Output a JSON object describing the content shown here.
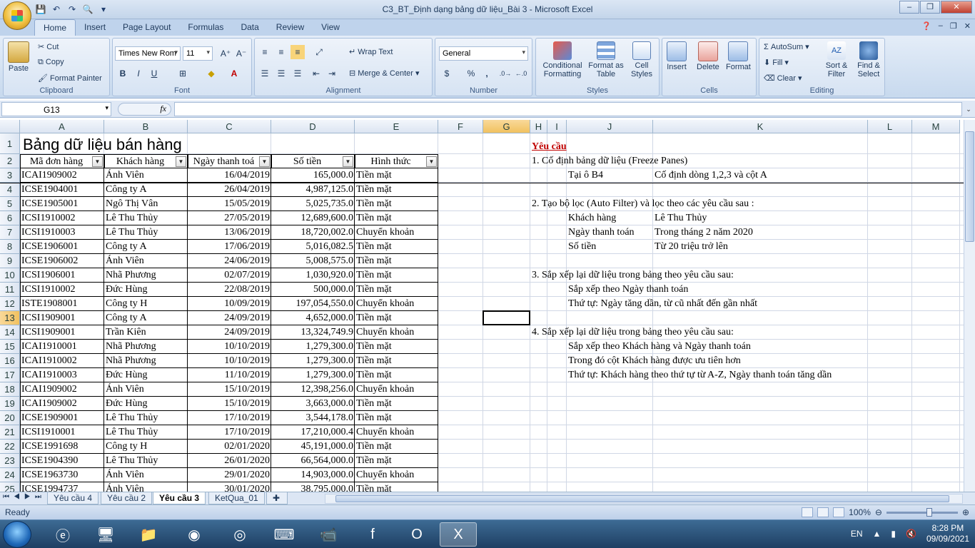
{
  "window": {
    "title": "C3_BT_Định dạng bảng dữ liệu_Bài 3 - Microsoft Excel"
  },
  "ribbon_tabs": [
    "Home",
    "Insert",
    "Page Layout",
    "Formulas",
    "Data",
    "Review",
    "View"
  ],
  "ribbon": {
    "clipboard": {
      "paste": "Paste",
      "cut": "Cut",
      "copy": "Copy",
      "format_painter": "Format Painter",
      "label": "Clipboard"
    },
    "font": {
      "name": "Times New Rom",
      "size": "11",
      "label": "Font",
      "bold": "B",
      "italic": "I",
      "underline": "U"
    },
    "alignment": {
      "wrap": "Wrap Text",
      "merge": "Merge & Center",
      "label": "Alignment"
    },
    "number": {
      "format": "General",
      "label": "Number",
      "currency": "$",
      "percent": "%",
      "comma": ","
    },
    "styles": {
      "conditional": "Conditional Formatting",
      "table": "Format as Table",
      "cell": "Cell Styles",
      "label": "Styles"
    },
    "cells": {
      "insert": "Insert",
      "delete": "Delete",
      "format": "Format",
      "label": "Cells"
    },
    "editing": {
      "autosum": "AutoSum",
      "fill": "Fill",
      "clear": "Clear",
      "sort": "Sort & Filter",
      "find": "Find & Select",
      "label": "Editing"
    }
  },
  "formula_bar": {
    "name_box": "G13",
    "fx": "fx",
    "value": ""
  },
  "columns": [
    "A",
    "B",
    "C",
    "D",
    "E",
    "F",
    "G",
    "H",
    "I",
    "J",
    "K",
    "L",
    "M"
  ],
  "rows": [
    "1",
    "2",
    "3",
    "4",
    "5",
    "6",
    "7",
    "8",
    "9",
    "10",
    "11",
    "12",
    "13",
    "14",
    "15",
    "16",
    "17",
    "18",
    "19",
    "20",
    "21",
    "22",
    "23",
    "24",
    "25"
  ],
  "sheet": {
    "title": "Bảng dữ liệu bán hàng",
    "headers": [
      "Mã đơn hàng",
      "Khách hàng",
      "Ngày thanh toá",
      "Số tiền",
      "Hình thức"
    ],
    "data": [
      [
        "ICAI1909002",
        "Ánh Viên",
        "16/04/2019",
        "165,000.0",
        "Tiền mặt"
      ],
      [
        "ICSE1904001",
        "Công ty A",
        "26/04/2019",
        "4,987,125.0",
        "Tiền mặt"
      ],
      [
        "ICSE1905001",
        "Ngô Thị Vân",
        "15/05/2019",
        "5,025,735.0",
        "Tiền mặt"
      ],
      [
        "ICSI1910002",
        "Lê Thu Thủy",
        "27/05/2019",
        "12,689,600.0",
        "Tiền mặt"
      ],
      [
        "ICSI1910003",
        "Lê Thu Thủy",
        "13/06/2019",
        "18,720,002.0",
        "Chuyển khoản"
      ],
      [
        "ICSE1906001",
        "Công ty A",
        "17/06/2019",
        "5,016,082.5",
        "Tiền mặt"
      ],
      [
        "ICSE1906002",
        "Ánh Viên",
        "24/06/2019",
        "5,008,575.0",
        "Tiền mặt"
      ],
      [
        "ICSI1906001",
        "Nhã Phương",
        "02/07/2019",
        "1,030,920.0",
        "Tiền mặt"
      ],
      [
        "ICSI1910002",
        "Đức Hùng",
        "22/08/2019",
        "500,000.0",
        "Tiền mặt"
      ],
      [
        "ISTE1908001",
        "Công ty H",
        "10/09/2019",
        "197,054,550.0",
        "Chuyển khoản"
      ],
      [
        "ICSI1909001",
        "Công ty A",
        "24/09/2019",
        "4,652,000.0",
        "Tiền mặt"
      ],
      [
        "ICSI1909001",
        "Trần Kiên",
        "24/09/2019",
        "13,324,749.9",
        "Chuyển khoản"
      ],
      [
        "ICAI1910001",
        "Nhã Phương",
        "10/10/2019",
        "1,279,300.0",
        "Tiền mặt"
      ],
      [
        "ICAI1910002",
        "Nhã Phương",
        "10/10/2019",
        "1,279,300.0",
        "Tiền mặt"
      ],
      [
        "ICAI1910003",
        "Đức Hùng",
        "11/10/2019",
        "1,279,300.0",
        "Tiền mặt"
      ],
      [
        "ICAI1909002",
        "Ánh Viên",
        "15/10/2019",
        "12,398,256.0",
        "Chuyển khoản"
      ],
      [
        "ICAI1909002",
        "Đức Hùng",
        "15/10/2019",
        "3,663,000.0",
        "Tiền mặt"
      ],
      [
        "ICSE1909001",
        "Lê Thu Thủy",
        "17/10/2019",
        "3,544,178.0",
        "Tiền mặt"
      ],
      [
        "ICSI1910001",
        "Lê Thu Thủy",
        "17/10/2019",
        "17,210,000.4",
        "Chuyển khoản"
      ],
      [
        "ICSE1991698",
        "Công ty H",
        "02/01/2020",
        "45,191,000.0",
        "Tiền mặt"
      ],
      [
        "ICSE1904390",
        "Lê Thu Thủy",
        "26/01/2020",
        "66,564,000.0",
        "Tiền mặt"
      ],
      [
        "ICSE1963730",
        "Ánh Viên",
        "29/01/2020",
        "14,903,000.0",
        "Chuyển khoản"
      ],
      [
        "ICSE1994737",
        "Ánh Viên",
        "30/01/2020",
        "38,795,000.0",
        "Tiền mặt"
      ]
    ]
  },
  "requirements": {
    "title": "Yêu cầu",
    "r1": "1. Cố định bảng dữ liệu (Freeze Panes)",
    "r1_a": "Tại ô B4",
    "r1_b": "Cố định dòng 1,2,3 và cột A",
    "r2": "2. Tạo bộ lọc (Auto Filter) và lọc theo các yêu cầu sau :",
    "r2_k1": "Khách hàng",
    "r2_v1": "Lê Thu Thủy",
    "r2_k2": "Ngày thanh toán",
    "r2_v2": "Trong tháng 2 năm 2020",
    "r2_k3": "Số tiền",
    "r2_v3": "Từ 20 triệu trở lên",
    "r3": "3. Sắp xếp lại dữ liệu trong bảng theo yêu cầu sau:",
    "r3_a": "Sắp xếp theo Ngày thanh toán",
    "r3_b": "Thứ tự: Ngày tăng dần, từ cũ nhất đến gần nhất",
    "r4": "4. Sắp xếp lại dữ liệu trong bảng theo yêu cầu sau:",
    "r4_a": "Sắp xếp theo Khách hàng và Ngày thanh toán",
    "r4_b": "Trong đó cột Khách hàng được ưu tiên hơn",
    "r4_c": "Thứ tự: Khách hàng theo thứ tự từ A-Z, Ngày thanh toán tăng dần"
  },
  "sheet_tabs": [
    "Yêu cầu 4",
    "Yêu cầu 2",
    "Yêu cầu 3",
    "KetQua_01"
  ],
  "active_sheet": "Yêu cầu 3",
  "status": {
    "text": "Ready",
    "zoom": "100%"
  },
  "taskbar": {
    "lang": "EN",
    "time": "8:28 PM",
    "date": "09/09/2021"
  }
}
